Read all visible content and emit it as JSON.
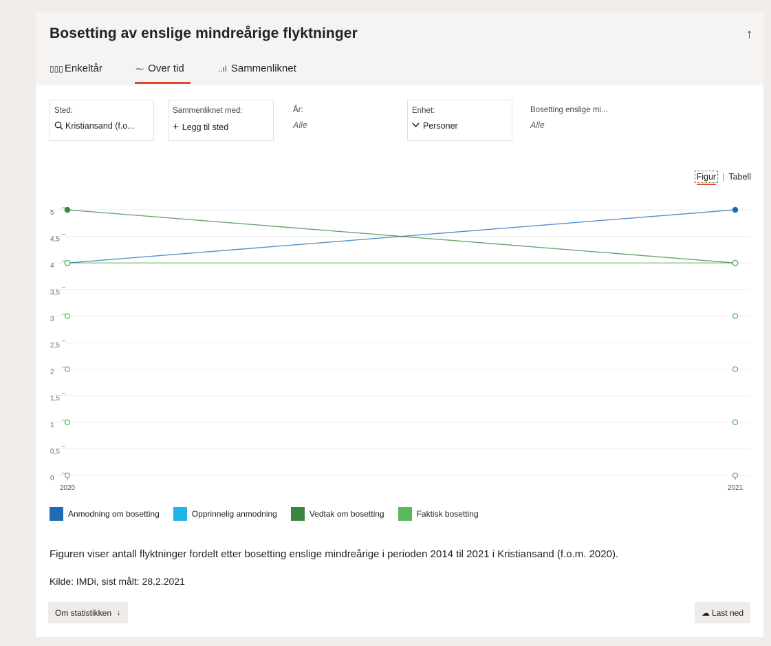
{
  "header": {
    "title": "Bosetting av enslige mindreårige flyktninger",
    "collapse_icon": "↑"
  },
  "tabs": [
    {
      "icon": "▯▯▯",
      "label": "Enkeltår"
    },
    {
      "icon": "⁓",
      "label": "Over tid"
    },
    {
      "icon": "..ıl",
      "label": "Sammenliknet"
    }
  ],
  "filters": {
    "sted": {
      "label": "Sted:",
      "value": "Kristiansand (f.o..."
    },
    "sammenliknet": {
      "label": "Sammenliknet med:",
      "value": "Legg til sted"
    },
    "ar": {
      "label": "År:",
      "value": "Alle"
    },
    "enhet": {
      "label": "Enhet:",
      "value": "Personer"
    },
    "bosetting": {
      "label": "Bosetting enslige mi...",
      "value": "Alle"
    }
  },
  "view_toggle": {
    "figur": "Figur",
    "separator": "|",
    "tabell": "Tabell"
  },
  "chart_data": {
    "type": "line",
    "x": [
      "2020",
      "2021"
    ],
    "ylim": [
      0,
      5
    ],
    "yticks": [
      "0",
      "0,5",
      "1",
      "1,5",
      "2",
      "2,5",
      "3",
      "3,5",
      "4",
      "4,5",
      "5"
    ],
    "grid": true,
    "series": [
      {
        "name": "Anmodning om bosetting",
        "color": "#1f6bb5",
        "values": [
          4,
          5
        ]
      },
      {
        "name": "Opprinnelig anmodning",
        "color": "#1fb4e4",
        "values": [
          null,
          null
        ]
      },
      {
        "name": "Vedtak om bosetting",
        "color": "#3a8540",
        "values": [
          5,
          4
        ]
      },
      {
        "name": "Faktisk bosetting",
        "color": "#5cb85c",
        "values": [
          4,
          4
        ]
      }
    ],
    "legend_position": "bottom"
  },
  "description": "Figuren viser antall flyktninger fordelt etter bosetting enslige mindreårige i perioden 2014 til 2021 i Kristiansand (f.o.m. 2020).",
  "source": "Kilde: IMDi, sist målt: 28.2.2021",
  "buttons": {
    "om": "Om statistikken",
    "om_icon": "↓",
    "last": "Last ned",
    "last_icon": "☁"
  }
}
